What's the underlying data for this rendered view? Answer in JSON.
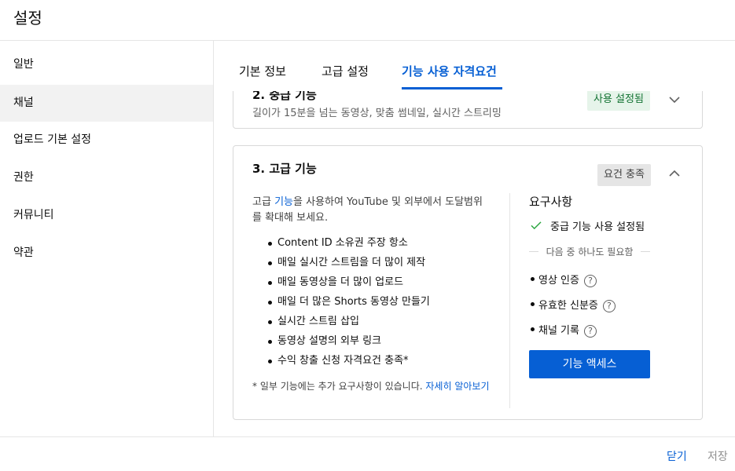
{
  "header": {
    "title": "설정"
  },
  "sidebar": {
    "items": [
      {
        "label": "일반",
        "active": false
      },
      {
        "label": "채널",
        "active": true
      },
      {
        "label": "업로드 기본 설정",
        "active": false
      },
      {
        "label": "권한",
        "active": false
      },
      {
        "label": "커뮤니티",
        "active": false
      },
      {
        "label": "약관",
        "active": false
      }
    ]
  },
  "tabs": [
    {
      "label": "기본 정보",
      "active": false
    },
    {
      "label": "고급 설정",
      "active": false
    },
    {
      "label": "기능 사용 자격요건",
      "active": true
    }
  ],
  "card2": {
    "title": "2. 중급 기능",
    "subtitle": "길이가 15분을 넘는 동영상, 맞춤 썸네일, 실시간 스트리밍",
    "badge": "사용 설정됨"
  },
  "card3": {
    "title": "3. 고급 기능",
    "badge": "요건 충족",
    "desc_prefix": "고급 ",
    "desc_link": "기능",
    "desc_suffix": "을 사용하여 YouTube 및 외부에서 도달범위를 확대해 보세요.",
    "features": [
      "Content ID 소유권 주장 항소",
      "매일 실시간 스트림을 더 많이 제작",
      "매일 동영상을 더 많이 업로드",
      "매일 더 많은 Shorts 동영상 만들기",
      "실시간 스트림 삽입",
      "동영상 설명의 외부 링크",
      "수익 창출 신청 자격요건 충족*"
    ],
    "footnote": "* 일부 기능에는 추가 요구사항이 있습니다. ",
    "footnote_link": "자세히 알아보기",
    "requirements_title": "요구사항",
    "met_requirement": "중급 기능 사용 설정됨",
    "need_one": "다음 중 하나도 필요함",
    "options": [
      "영상 인증",
      "유효한 신분증",
      "채널 기록"
    ],
    "access_button": "기능 액세스"
  },
  "footer": {
    "close": "닫기",
    "save": "저장"
  },
  "colors": {
    "accent": "#065fd4",
    "enabled_bg": "#e6f4ea",
    "enabled_text": "#137333"
  }
}
